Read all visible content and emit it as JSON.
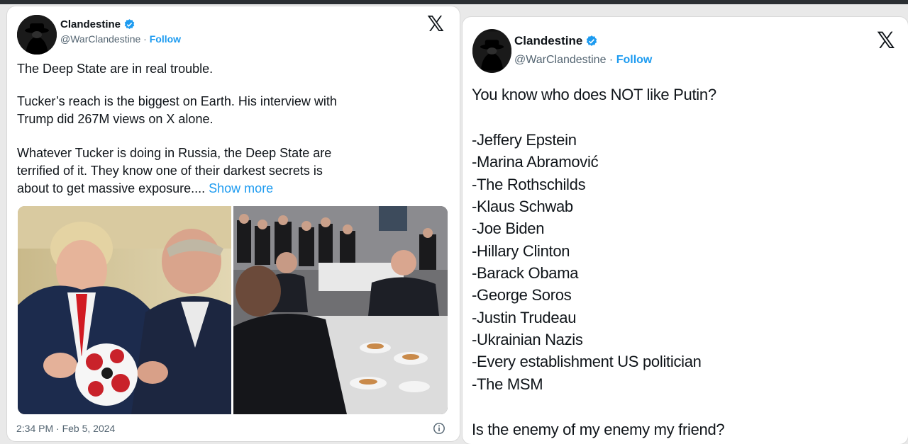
{
  "left_tweet": {
    "display_name": "Clandestine",
    "handle": "@WarClandestine",
    "separator": " · ",
    "follow_label": "Follow",
    "x_logo": "𝕏",
    "paragraph_1": "The Deep State are in real trouble.",
    "paragraph_2": "Tucker’s reach is the biggest on Earth. His interview with\nTrump did 267M views on X alone.",
    "paragraph_3": "Whatever Tucker is doing in Russia, the Deep State are\nterrified of it. They know one of their darkest secrets is\nabout to get massive exposure.... ",
    "show_more_label": "Show more",
    "timestamp": "2:34 PM · Feb 5, 2024",
    "info_icon": "info-icon"
  },
  "right_tweet": {
    "display_name": "Clandestine",
    "handle": "@WarClandestine",
    "separator": " · ",
    "follow_label": "Follow",
    "x_logo": "𝕏",
    "question": "You know who does NOT like Putin?",
    "list": [
      "-Jeffery Epstein",
      "-Marina Abramović",
      "-The Rothschilds",
      "-Klaus Schwab",
      "-Joe Biden",
      "-Hillary Clinton",
      "-Barack Obama",
      "-George Soros",
      "-Justin Trudeau",
      "-Ukrainian Nazis",
      "-Every establishment US politician",
      "-The MSM"
    ],
    "closing": "Is the enemy of my enemy my friend?"
  },
  "colors": {
    "link_blue": "#1d9bf0",
    "secondary_text": "#536471",
    "verified_blue": "#1d9bf0"
  }
}
